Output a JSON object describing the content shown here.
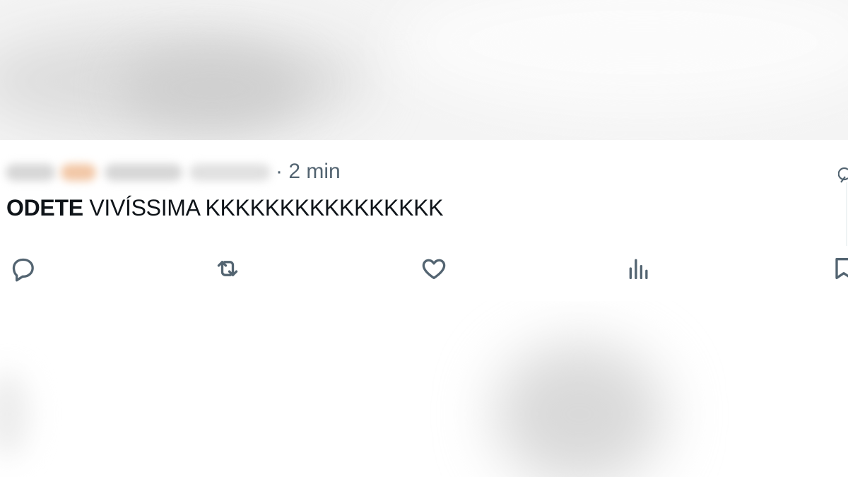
{
  "tweet": {
    "time": "· 2 min",
    "text_bold": "ODETE",
    "text_rest": " VIVÍSSIMA KKKKKKKKKKKKKKKK"
  },
  "actions": {
    "reply": "reply-icon",
    "retweet": "retweet-icon",
    "like": "heart-icon",
    "views": "analytics-icon",
    "bookmark": "bookmark-icon"
  },
  "colors": {
    "text": "#0f1419",
    "muted": "#536471"
  }
}
